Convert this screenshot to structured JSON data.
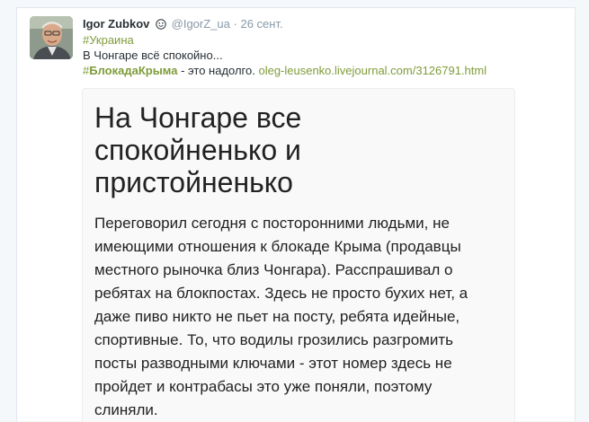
{
  "tweet": {
    "author": {
      "fullname": "Igor Zubkov",
      "screen_name": "@IgorZ_ua",
      "avatar_alt": "profile photo"
    },
    "dot": "·",
    "timestamp": "26 сент.",
    "text": {
      "hashtag1": "#Украина",
      "line2": "В Чонгаре всё спокойно...",
      "hashtag2_hash": "#",
      "hashtag2_word": "БлокадаКрыма",
      "line3_mid": " - это надолго. ",
      "link": "oleg-leusenko.livejournal.com/3126791.html"
    },
    "colors": {
      "link": "#7f9c3a",
      "name": "#292f33",
      "muted": "#8899a6"
    }
  },
  "card": {
    "title_lines": [
      "На Чонгаре все",
      "спокойненько и",
      "пристойненько"
    ],
    "body_lines": [
      "Переговорил сегодня с посторонними людьми, не",
      "имеющими отношения к блокаде Крыма (продавцы",
      "местного рыночка близ Чонгара). Расспрашивал о",
      "ребятах на блокпостах. Здесь не просто бухих нет, а",
      "даже пиво никто не пьет на посту, ребята идейные,",
      "спортивные. То, что водилы грозились разгромить",
      "посты разводными ключами - этот номер здесь не",
      "пройдет и контрабасы это уже поняли, поэтому",
      "слиняли."
    ]
  }
}
